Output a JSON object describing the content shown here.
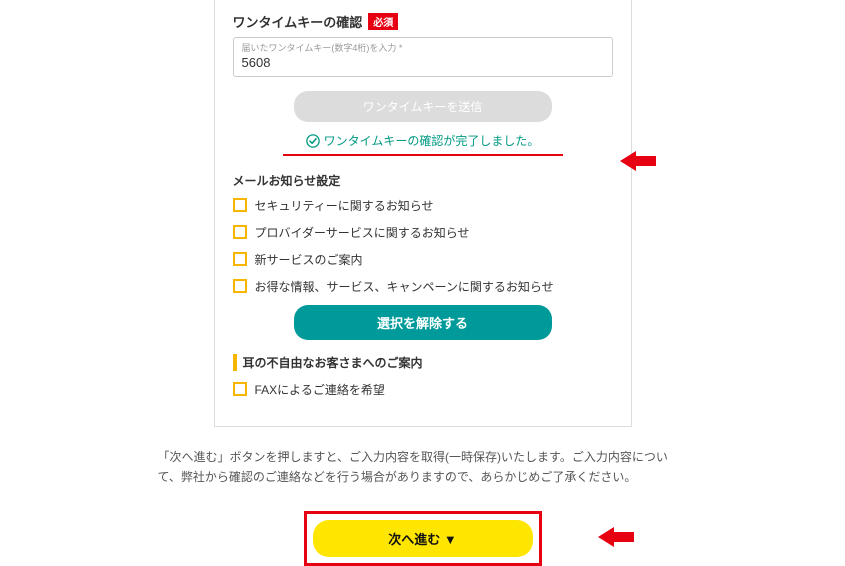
{
  "otk": {
    "title": "ワンタイムキーの確認",
    "required": "必須",
    "floatingLabel": "届いたワンタイムキー(数字4桁)を入力 *",
    "value": "5608",
    "sendButton": "ワンタイムキーを送信",
    "confirmMessage": "ワンタイムキーの確認が完了しました。"
  },
  "mail": {
    "title": "メールお知らせ設定",
    "options": [
      "セキュリティーに関するお知らせ",
      "プロバイダーサービスに関するお知らせ",
      "新サービスのご案内",
      "お得な情報、サービス、キャンペーンに関するお知らせ"
    ],
    "deselectButton": "選択を解除する"
  },
  "accessibility": {
    "title": "耳の不自由なお客さまへのご案内",
    "option": "FAXによるご連絡を希望"
  },
  "infoText": "「次へ進む」ボタンを押しますと、ご入力内容を取得(一時保存)いたします。ご入力内容について、弊社から確認のご連絡などを行う場合がありますので、あらかじめご了承ください。",
  "nextButton": "次へ進む ▼"
}
